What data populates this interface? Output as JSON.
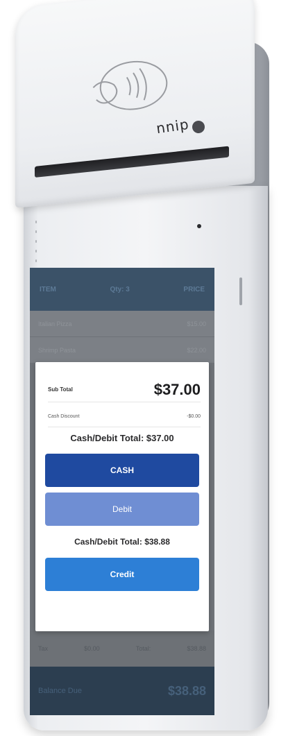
{
  "device": {
    "brand": "nnip",
    "nfc_icon": "contactless-payment-icon"
  },
  "screen": {
    "header": {
      "col1": "ITEM",
      "col2": "Qty: 3",
      "col3": "PRICE"
    },
    "items": [
      {
        "name": "Italian Pizza",
        "price": "$15.00"
      },
      {
        "name": "Shrimp Pasta",
        "price": "$22.00"
      }
    ],
    "footer": {
      "tax_label": "Tax",
      "tax_value": "$0.00",
      "total_label": "Total:",
      "total_value": "$38.88"
    },
    "balance": {
      "label": "Balance Due",
      "amount": "$38.88"
    },
    "modal": {
      "subtotal_label": "Sub Total",
      "subtotal_value": "$37.00",
      "discount_label": "Cash Discount",
      "discount_value": "-$0.00",
      "cash_debit_total": "Cash/Debit Total: $37.00",
      "cash_button": "CASH",
      "debit_button": "Debit",
      "credit_total": "Cash/Debit Total: $38.88",
      "credit_button": "Credit"
    }
  }
}
